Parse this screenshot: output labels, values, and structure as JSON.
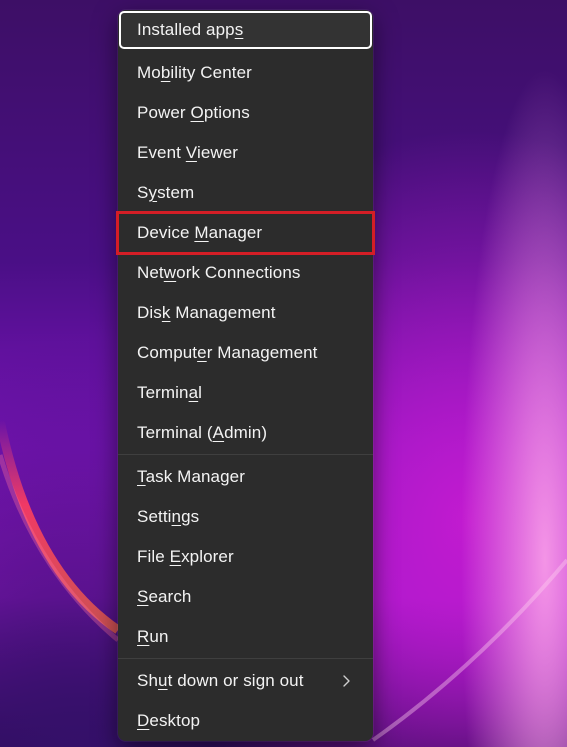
{
  "menu": {
    "items": [
      {
        "label": "Installed apps",
        "underline_index": 13
      },
      {
        "label": "Mobility Center",
        "underline_index": 2
      },
      {
        "label": "Power Options",
        "underline_index": 6
      },
      {
        "label": "Event Viewer",
        "underline_index": 6
      },
      {
        "label": "System",
        "underline_index": 1
      },
      {
        "label": "Device Manager",
        "underline_index": 7
      },
      {
        "label": "Network Connections",
        "underline_index": 3
      },
      {
        "label": "Disk Management",
        "underline_index": 3
      },
      {
        "label": "Computer Management",
        "underline_index": 6
      },
      {
        "label": "Terminal",
        "underline_index": 6
      },
      {
        "label": "Terminal (Admin)",
        "underline_index": 10
      },
      {
        "label": "Task Manager",
        "underline_index": 0
      },
      {
        "label": "Settings",
        "underline_index": 5
      },
      {
        "label": "File Explorer",
        "underline_index": 5
      },
      {
        "label": "Search",
        "underline_index": 0
      },
      {
        "label": "Run",
        "underline_index": 0
      },
      {
        "label": "Shut down or sign out",
        "underline_index": 2,
        "has_submenu": true
      },
      {
        "label": "Desktop",
        "underline_index": 0
      }
    ],
    "focused_item": "Installed apps",
    "highlighted_item": "Device Manager",
    "highlight_color": "#d41e26",
    "background_color": "#2c2c2c",
    "submenu_icon": "chevron-right-icon"
  }
}
